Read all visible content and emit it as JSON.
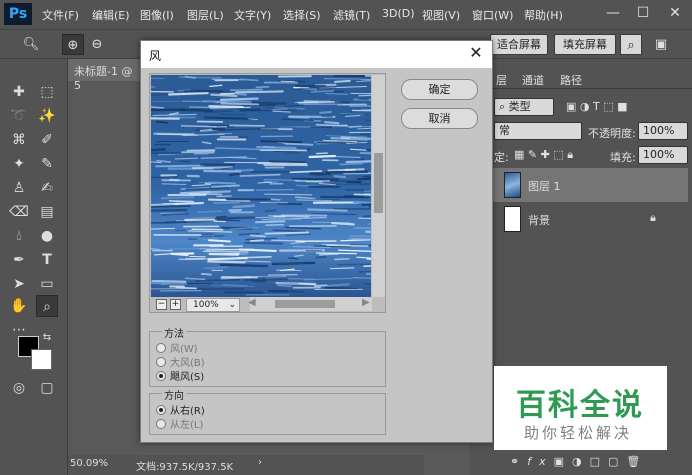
{
  "app": {
    "logo": "Ps",
    "menu": [
      "文件(F)",
      "编辑(E)",
      "图像(I)",
      "图层(L)",
      "文字(Y)",
      "选择(S)",
      "滤镜(T)",
      "3D(D)",
      "视图(V)",
      "窗口(W)",
      "帮助(H)"
    ],
    "window_controls": [
      "—",
      "☐",
      "✕"
    ]
  },
  "options_bar": {
    "fit_screen": "适合屏幕",
    "fill_screen": "填充屏幕"
  },
  "document": {
    "tab_label": "未标题-1 @ 5",
    "zoom": "50.09%",
    "doc_size": "文档:937.5K/937.5K"
  },
  "right_panel": {
    "tabs": [
      "层",
      "通道",
      "路径"
    ],
    "kind_label": "类型",
    "blend_mode": "常",
    "opacity_label": "不透明度:",
    "opacity_value": "100%",
    "lock_label": "定:",
    "fill_label": "填充:",
    "fill_value": "100%",
    "layers": [
      {
        "name": "图层 1"
      },
      {
        "name": "背景"
      }
    ]
  },
  "dialog": {
    "title": "风",
    "ok_label": "确定",
    "cancel_label": "取消",
    "zoom_value": "100%",
    "method_group": {
      "title": "方法",
      "options": [
        {
          "label": "风(W)",
          "checked": false
        },
        {
          "label": "大风(B)",
          "checked": false
        },
        {
          "label": "飓风(S)",
          "checked": true
        }
      ]
    },
    "direction_group": {
      "title": "方向",
      "options": [
        {
          "label": "从右(R)",
          "checked": true
        },
        {
          "label": "从左(L)",
          "checked": false
        }
      ]
    }
  },
  "watermark": {
    "title": "百科全说",
    "subtitle": "助你轻松解决"
  },
  "colors": {
    "chrome": "#535353",
    "dialog_bg": "#c5c5c5",
    "wm_green": "#2e9a52"
  }
}
